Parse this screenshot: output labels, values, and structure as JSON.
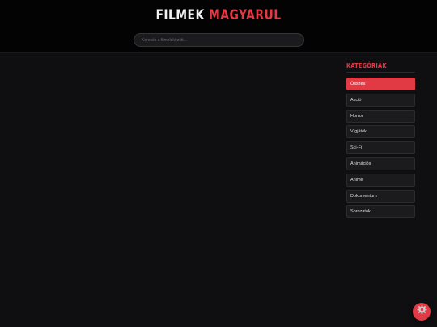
{
  "header": {
    "logo_part1": "FILMEK",
    "logo_part2": "MAGYARUL",
    "search_placeholder": "Keresés a filmek között..."
  },
  "sidebar": {
    "title": "KATEGÓRIÁK",
    "items": [
      {
        "label": "Összes",
        "active": true
      },
      {
        "label": "Akció",
        "active": false
      },
      {
        "label": "Horror",
        "active": false
      },
      {
        "label": "Vígjáték",
        "active": false
      },
      {
        "label": "Sci-Fi",
        "active": false
      },
      {
        "label": "Animációs",
        "active": false
      },
      {
        "label": "Anime",
        "active": false
      },
      {
        "label": "Dokumentum",
        "active": false
      },
      {
        "label": "Sorozatok",
        "active": false
      }
    ]
  },
  "fab": {
    "icon": "gear-icon"
  },
  "colors": {
    "accent": "#e23a45",
    "background": "#0f0f12",
    "header": "#030303"
  }
}
